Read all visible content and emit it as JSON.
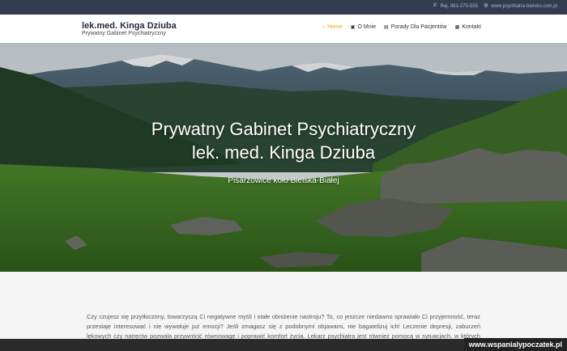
{
  "topbar": {
    "phone_icon": "phone-icon",
    "phone": "Rej. 881-275-555",
    "globe_icon": "globe-icon",
    "website": "www.psychiatra-bielsko.com.pl"
  },
  "header": {
    "title": "lek.med. Kinga Dziuba",
    "subtitle": "Prywatny Gabinet Psychiatryczny"
  },
  "nav": {
    "items": [
      {
        "label": "Home",
        "icon": "home-icon",
        "active": true
      },
      {
        "label": "O Mnie",
        "icon": "document-icon"
      },
      {
        "label": "Porady Dla Pacjentów",
        "icon": "book-icon"
      },
      {
        "label": "Kontakt",
        "icon": "contact-icon"
      }
    ]
  },
  "hero": {
    "title_line1": "Prywatny Gabinet Psychiatryczny",
    "title_line2": "lek. med. Kinga Dziuba",
    "location": "Pisarzowice koło Bielska-Białej"
  },
  "content": {
    "paragraph": "Czy czujesz się przytłoczony, towarzyszą Ci negatywne myśli i stałe obniżenie nastroju? To, co jeszcze niedawno sprawiało Ci przyjemność, teraz przestaje interesować i nie wywołuje już emocji? Jeśli zmagasz się z podobnymi objawami, nie bagatelizuj ich! Leczenie depresji, zaburzeń lękowych czy natręctw pozwala przywrócić równowagę i poprawić komfort życia. Lekarz psychiatra jest również pomocą w sytuacjach, w których problemem jest radzenie sobie ze stresem, związanym z trudnymi przeżyciami. W takich momentach konsultacja"
  },
  "watermark": "www.wspanialypoczatek.pl",
  "colors": {
    "topbar_bg": "#313d4f",
    "nav_active": "#e1a81f"
  }
}
